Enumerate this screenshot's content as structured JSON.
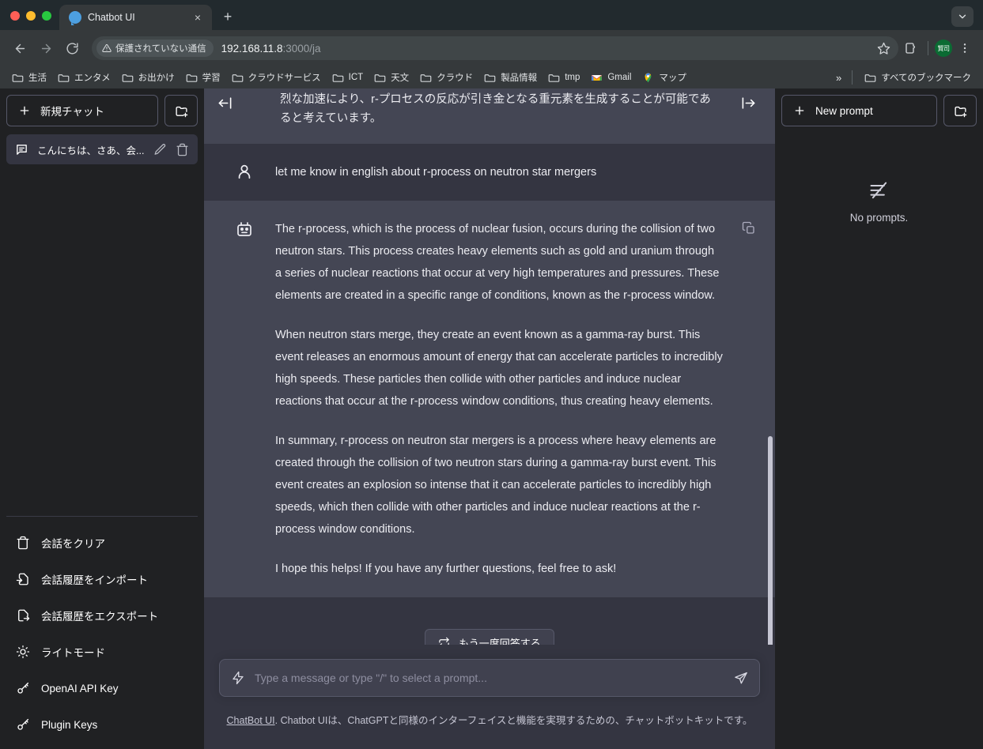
{
  "browser": {
    "tab": {
      "title": "Chatbot UI",
      "favicon": "chat-bubble-icon",
      "close_label": "×"
    },
    "new_tab_label": "+",
    "omnibox": {
      "security_chip": "保護されていない通信",
      "url_host": "192.168.11.8",
      "url_rest": ":3000/ja"
    },
    "profile_initials": "賢司",
    "bookmarks": [
      {
        "label": "生活",
        "icon": "folder-icon"
      },
      {
        "label": "エンタメ",
        "icon": "folder-icon"
      },
      {
        "label": "お出かけ",
        "icon": "folder-icon"
      },
      {
        "label": "学習",
        "icon": "folder-icon"
      },
      {
        "label": "クラウドサービス",
        "icon": "folder-icon"
      },
      {
        "label": "ICT",
        "icon": "folder-icon"
      },
      {
        "label": "天文",
        "icon": "folder-icon"
      },
      {
        "label": "クラウド",
        "icon": "folder-icon"
      },
      {
        "label": "製品情報",
        "icon": "folder-icon"
      },
      {
        "label": "tmp",
        "icon": "folder-icon"
      },
      {
        "label": "Gmail",
        "icon": "gmail-icon"
      },
      {
        "label": "マップ",
        "icon": "maps-pin-icon"
      }
    ],
    "bookmarks_overflow": "»",
    "all_bookmarks_label": "すべてのブックマーク"
  },
  "sidebar_left": {
    "new_chat_label": "新規チャット",
    "new_folder_icon": "folder-plus-icon",
    "conversations": [
      {
        "title": "こんにちは、さあ、会...",
        "icon": "message-icon"
      }
    ],
    "menu": [
      {
        "label": "会話をクリア",
        "icon": "trash-icon"
      },
      {
        "label": "会話履歴をインポート",
        "icon": "file-import-icon"
      },
      {
        "label": "会話履歴をエクスポート",
        "icon": "file-export-icon"
      },
      {
        "label": "ライトモード",
        "icon": "sun-icon"
      },
      {
        "label": "OpenAI API Key",
        "icon": "key-icon"
      },
      {
        "label": "Plugin Keys",
        "icon": "key-icon"
      }
    ]
  },
  "chat": {
    "toggle_left_icon": "collapse-left-icon",
    "toggle_right_icon": "collapse-right-icon",
    "partial_message": {
      "role": "assistant",
      "line_clipped": "烈な加速により、r-プロセスの反応が引き金となる重元素を生成することが可能であ",
      "line_visible": "ると考えています。"
    },
    "messages": [
      {
        "role": "user",
        "avatar_icon": "user-icon",
        "paragraphs": [
          "let me know in english about r-process on neutron star mergers"
        ]
      },
      {
        "role": "assistant",
        "avatar_icon": "robot-icon",
        "copy_icon": "copy-icon",
        "paragraphs": [
          "The r-process, which is the process of nuclear fusion, occurs during the collision of two neutron stars. This process creates heavy elements such as gold and uranium through a series of nuclear reactions that occur at very high temperatures and pressures. These elements are created in a specific range of conditions, known as the r-process window.",
          "When neutron stars merge, they create an event known as a gamma-ray burst. This event releases an enormous amount of energy that can accelerate particles to incredibly high speeds. These particles then collide with other particles and induce nuclear reactions that occur at the r-process window conditions, thus creating heavy elements.",
          "In summary, r-process on neutron star mergers is a process where heavy elements are created through the collision of two neutron stars during a gamma-ray burst event. This event creates an explosion so intense that it can accelerate particles to incredibly high speeds, which then collide with other particles and induce nuclear reactions at the r-process window conditions.",
          "I hope this helps! If you have any further questions, feel free to ask!"
        ]
      }
    ],
    "regenerate_label": "もう一度回答する",
    "regenerate_icon": "refresh-icon",
    "scroll_down_icon": "arrow-down-icon",
    "composer": {
      "placeholder": "Type a message or type \"/\" to select a prompt...",
      "value": "",
      "left_icon": "bolt-icon",
      "send_icon": "send-icon"
    },
    "footer": {
      "link_label": "ChatBot UI",
      "text": ". Chatbot UIは、ChatGPTと同様のインターフェイスと機能を実現するための、チャットボットキットです。"
    }
  },
  "sidebar_right": {
    "new_prompt_label": "New prompt",
    "new_folder_icon": "folder-plus-icon",
    "empty_icon": "no-prompts-icon",
    "empty_text": "No prompts."
  },
  "colors": {
    "chat_bg": "#343541",
    "assistant_bg": "#444654",
    "sidebar_bg": "#202123",
    "browser_chrome": "#35393b",
    "tabstrip": "#222a2e",
    "border": "#565869"
  }
}
